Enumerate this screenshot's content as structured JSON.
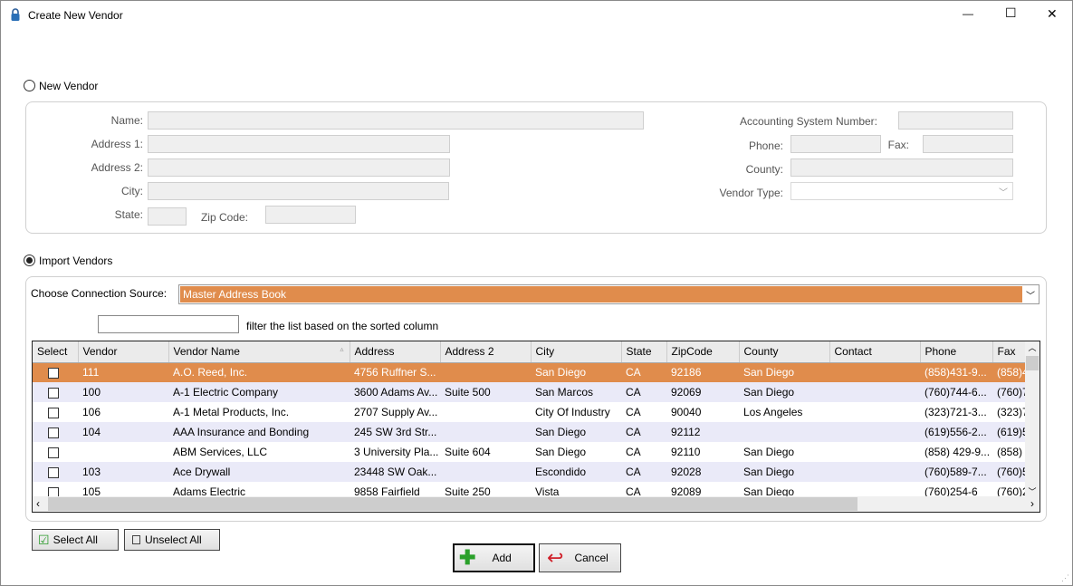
{
  "window": {
    "title": "Create New Vendor",
    "minimize": "—",
    "maximize": "☐",
    "close": "✕"
  },
  "new_vendor": {
    "label": "New Vendor",
    "selected": false,
    "fields": {
      "name": "Name:",
      "address1": "Address 1:",
      "address2": "Address 2:",
      "city": "City:",
      "state": "State:",
      "zip": "Zip Code:",
      "acct": "Accounting System Number:",
      "phone": "Phone:",
      "fax": "Fax:",
      "county": "County:",
      "vendor_type": "Vendor Type:"
    }
  },
  "import_vendors": {
    "label": "Import Vendors",
    "selected": true,
    "source_label": "Choose Connection Source:",
    "source_value": "Master Address Book",
    "filter_value": "",
    "filter_hint": "filter the list based on the sorted column"
  },
  "accent": "#e08c4c",
  "grid": {
    "columns": [
      "Select",
      "Vendor",
      "Vendor Name",
      "Address",
      "Address 2",
      "City",
      "State",
      "ZipCode",
      "County",
      "Contact",
      "Phone",
      "Fax"
    ],
    "sorted_column": "Vendor Name",
    "rows": [
      [
        "",
        "111",
        "A.O. Reed, Inc.",
        "4756 Ruffner S...",
        "",
        "San Diego",
        "CA",
        "92186",
        "San Diego",
        "",
        "(858)431-9...",
        "(858)4"
      ],
      [
        "",
        "100",
        "A-1 Electric Company",
        "3600 Adams Av...",
        "Suite 500",
        "San Marcos",
        "CA",
        "92069",
        "San Diego",
        "",
        "(760)744-6...",
        "(760)7"
      ],
      [
        "",
        "106",
        "A-1 Metal Products, Inc.",
        "2707 Supply Av...",
        "",
        "City Of Industry",
        "CA",
        "90040",
        "Los Angeles",
        "",
        "(323)721-3...",
        "(323)7"
      ],
      [
        "",
        "104",
        "AAA Insurance and Bonding",
        "245 SW 3rd Str...",
        "",
        "San Diego",
        "CA",
        "92112",
        "",
        "",
        "(619)556-2...",
        "(619)5"
      ],
      [
        "",
        "",
        "ABM Services, LLC",
        "3 University Pla...",
        "Suite 604",
        "San Diego",
        "CA",
        "92110",
        "San Diego",
        "",
        "(858) 429-9...",
        "(858) 4"
      ],
      [
        "",
        "103",
        "Ace Drywall",
        "23448 SW Oak...",
        "",
        "Escondido",
        "CA",
        "92028",
        "San Diego",
        "",
        "(760)589-7...",
        "(760)5"
      ],
      [
        "",
        "105",
        "Adams Electric",
        "9858 Fairfield",
        "Suite 250",
        "Vista",
        "CA",
        "92089",
        "San Diego",
        "",
        "(760)254-6",
        "(760)2"
      ]
    ]
  },
  "buttons": {
    "select_all": "Select All",
    "unselect_all": "Unselect All",
    "add": "Add",
    "cancel": "Cancel"
  }
}
